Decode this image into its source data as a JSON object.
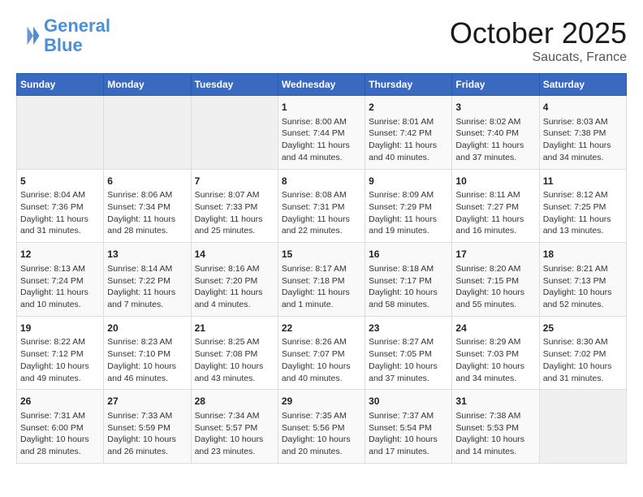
{
  "header": {
    "logo_line1": "General",
    "logo_line2": "Blue",
    "month": "October 2025",
    "location": "Saucats, France"
  },
  "days_of_week": [
    "Sunday",
    "Monday",
    "Tuesday",
    "Wednesday",
    "Thursday",
    "Friday",
    "Saturday"
  ],
  "weeks": [
    [
      {
        "day": "",
        "info": ""
      },
      {
        "day": "",
        "info": ""
      },
      {
        "day": "",
        "info": ""
      },
      {
        "day": "1",
        "info": "Sunrise: 8:00 AM\nSunset: 7:44 PM\nDaylight: 11 hours\nand 44 minutes."
      },
      {
        "day": "2",
        "info": "Sunrise: 8:01 AM\nSunset: 7:42 PM\nDaylight: 11 hours\nand 40 minutes."
      },
      {
        "day": "3",
        "info": "Sunrise: 8:02 AM\nSunset: 7:40 PM\nDaylight: 11 hours\nand 37 minutes."
      },
      {
        "day": "4",
        "info": "Sunrise: 8:03 AM\nSunset: 7:38 PM\nDaylight: 11 hours\nand 34 minutes."
      }
    ],
    [
      {
        "day": "5",
        "info": "Sunrise: 8:04 AM\nSunset: 7:36 PM\nDaylight: 11 hours\nand 31 minutes."
      },
      {
        "day": "6",
        "info": "Sunrise: 8:06 AM\nSunset: 7:34 PM\nDaylight: 11 hours\nand 28 minutes."
      },
      {
        "day": "7",
        "info": "Sunrise: 8:07 AM\nSunset: 7:33 PM\nDaylight: 11 hours\nand 25 minutes."
      },
      {
        "day": "8",
        "info": "Sunrise: 8:08 AM\nSunset: 7:31 PM\nDaylight: 11 hours\nand 22 minutes."
      },
      {
        "day": "9",
        "info": "Sunrise: 8:09 AM\nSunset: 7:29 PM\nDaylight: 11 hours\nand 19 minutes."
      },
      {
        "day": "10",
        "info": "Sunrise: 8:11 AM\nSunset: 7:27 PM\nDaylight: 11 hours\nand 16 minutes."
      },
      {
        "day": "11",
        "info": "Sunrise: 8:12 AM\nSunset: 7:25 PM\nDaylight: 11 hours\nand 13 minutes."
      }
    ],
    [
      {
        "day": "12",
        "info": "Sunrise: 8:13 AM\nSunset: 7:24 PM\nDaylight: 11 hours\nand 10 minutes."
      },
      {
        "day": "13",
        "info": "Sunrise: 8:14 AM\nSunset: 7:22 PM\nDaylight: 11 hours\nand 7 minutes."
      },
      {
        "day": "14",
        "info": "Sunrise: 8:16 AM\nSunset: 7:20 PM\nDaylight: 11 hours\nand 4 minutes."
      },
      {
        "day": "15",
        "info": "Sunrise: 8:17 AM\nSunset: 7:18 PM\nDaylight: 11 hours\nand 1 minute."
      },
      {
        "day": "16",
        "info": "Sunrise: 8:18 AM\nSunset: 7:17 PM\nDaylight: 10 hours\nand 58 minutes."
      },
      {
        "day": "17",
        "info": "Sunrise: 8:20 AM\nSunset: 7:15 PM\nDaylight: 10 hours\nand 55 minutes."
      },
      {
        "day": "18",
        "info": "Sunrise: 8:21 AM\nSunset: 7:13 PM\nDaylight: 10 hours\nand 52 minutes."
      }
    ],
    [
      {
        "day": "19",
        "info": "Sunrise: 8:22 AM\nSunset: 7:12 PM\nDaylight: 10 hours\nand 49 minutes."
      },
      {
        "day": "20",
        "info": "Sunrise: 8:23 AM\nSunset: 7:10 PM\nDaylight: 10 hours\nand 46 minutes."
      },
      {
        "day": "21",
        "info": "Sunrise: 8:25 AM\nSunset: 7:08 PM\nDaylight: 10 hours\nand 43 minutes."
      },
      {
        "day": "22",
        "info": "Sunrise: 8:26 AM\nSunset: 7:07 PM\nDaylight: 10 hours\nand 40 minutes."
      },
      {
        "day": "23",
        "info": "Sunrise: 8:27 AM\nSunset: 7:05 PM\nDaylight: 10 hours\nand 37 minutes."
      },
      {
        "day": "24",
        "info": "Sunrise: 8:29 AM\nSunset: 7:03 PM\nDaylight: 10 hours\nand 34 minutes."
      },
      {
        "day": "25",
        "info": "Sunrise: 8:30 AM\nSunset: 7:02 PM\nDaylight: 10 hours\nand 31 minutes."
      }
    ],
    [
      {
        "day": "26",
        "info": "Sunrise: 7:31 AM\nSunset: 6:00 PM\nDaylight: 10 hours\nand 28 minutes."
      },
      {
        "day": "27",
        "info": "Sunrise: 7:33 AM\nSunset: 5:59 PM\nDaylight: 10 hours\nand 26 minutes."
      },
      {
        "day": "28",
        "info": "Sunrise: 7:34 AM\nSunset: 5:57 PM\nDaylight: 10 hours\nand 23 minutes."
      },
      {
        "day": "29",
        "info": "Sunrise: 7:35 AM\nSunset: 5:56 PM\nDaylight: 10 hours\nand 20 minutes."
      },
      {
        "day": "30",
        "info": "Sunrise: 7:37 AM\nSunset: 5:54 PM\nDaylight: 10 hours\nand 17 minutes."
      },
      {
        "day": "31",
        "info": "Sunrise: 7:38 AM\nSunset: 5:53 PM\nDaylight: 10 hours\nand 14 minutes."
      },
      {
        "day": "",
        "info": ""
      }
    ]
  ]
}
